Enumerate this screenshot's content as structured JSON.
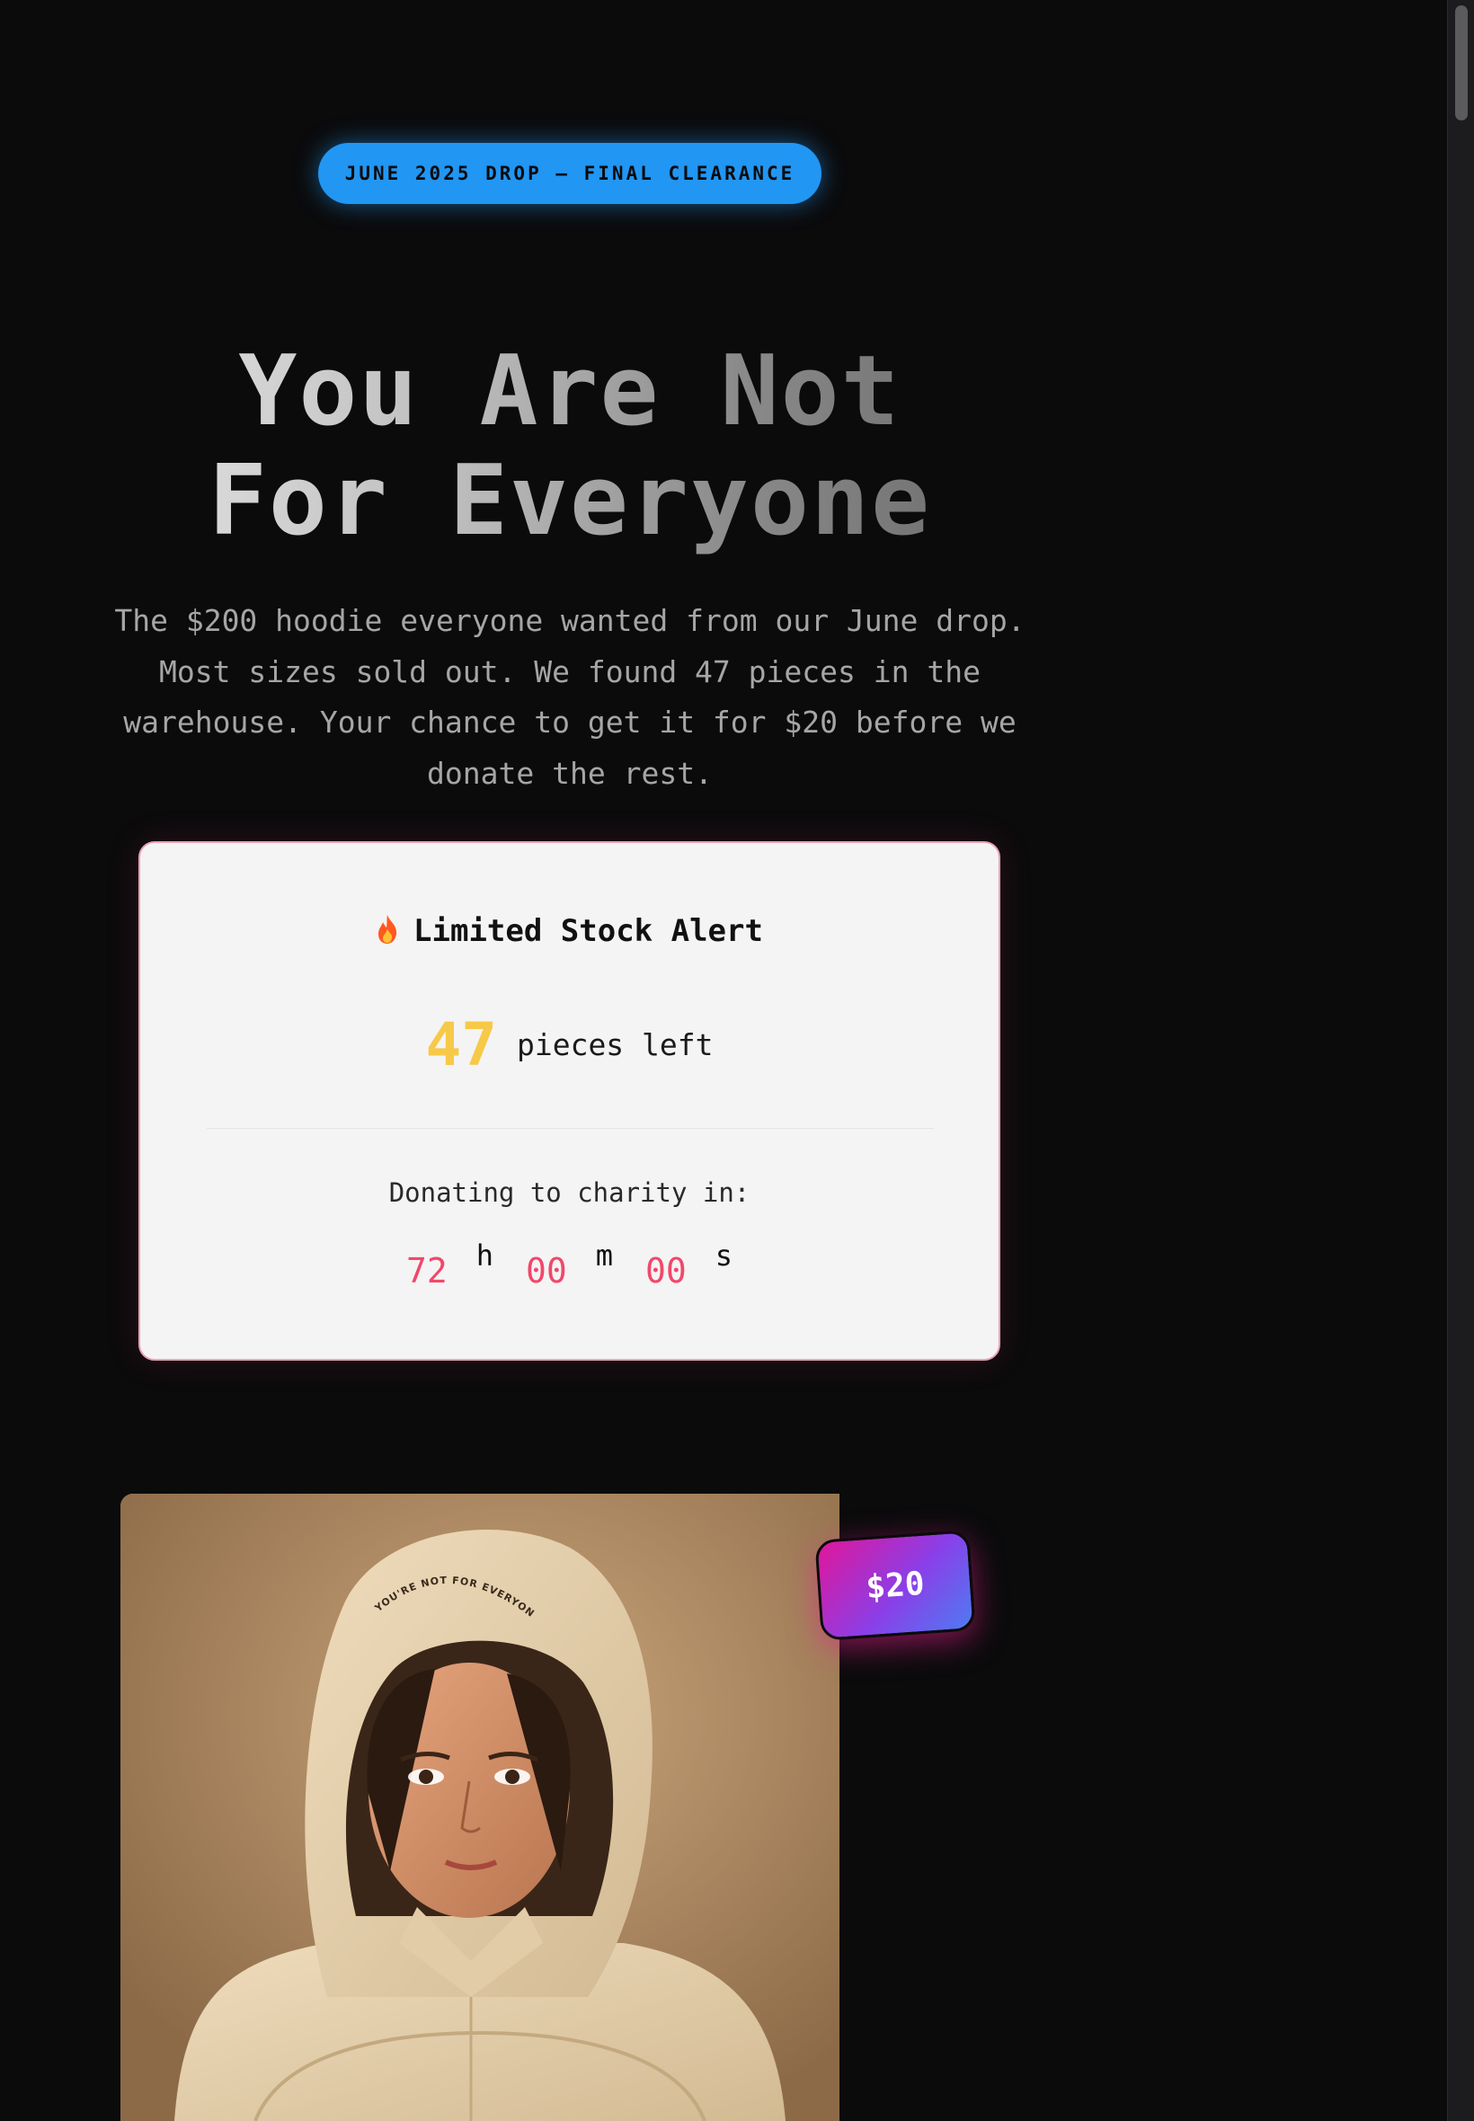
{
  "badge": {
    "text": "JUNE 2025 DROP – FINAL CLEARANCE"
  },
  "headline": {
    "line1": "You Are Not",
    "line2": "For Everyone"
  },
  "description": "The $200 hoodie everyone wanted from our June drop. Most sizes sold out. We found 47 pieces in the warehouse. Your chance to get it for $20 before we donate the rest.",
  "stock_card": {
    "title": "Limited Stock Alert",
    "icon": "flame-icon",
    "count": "47",
    "count_label": "pieces left",
    "donate_label": "Donating to charity in:",
    "countdown": {
      "hours": "72",
      "hours_unit": "h",
      "minutes": "00",
      "minutes_unit": "m",
      "seconds": "00",
      "seconds_unit": "s"
    }
  },
  "product": {
    "hood_print": "YOU'RE NOT FOR EVERYONE",
    "price": "$20"
  },
  "colors": {
    "background": "#0b0b0c",
    "badge": "#2196f3",
    "stock_count": "#f7c948",
    "countdown": "#f2476a",
    "price_gradient_start": "#e0169a",
    "price_gradient_end": "#4e7bf2"
  }
}
